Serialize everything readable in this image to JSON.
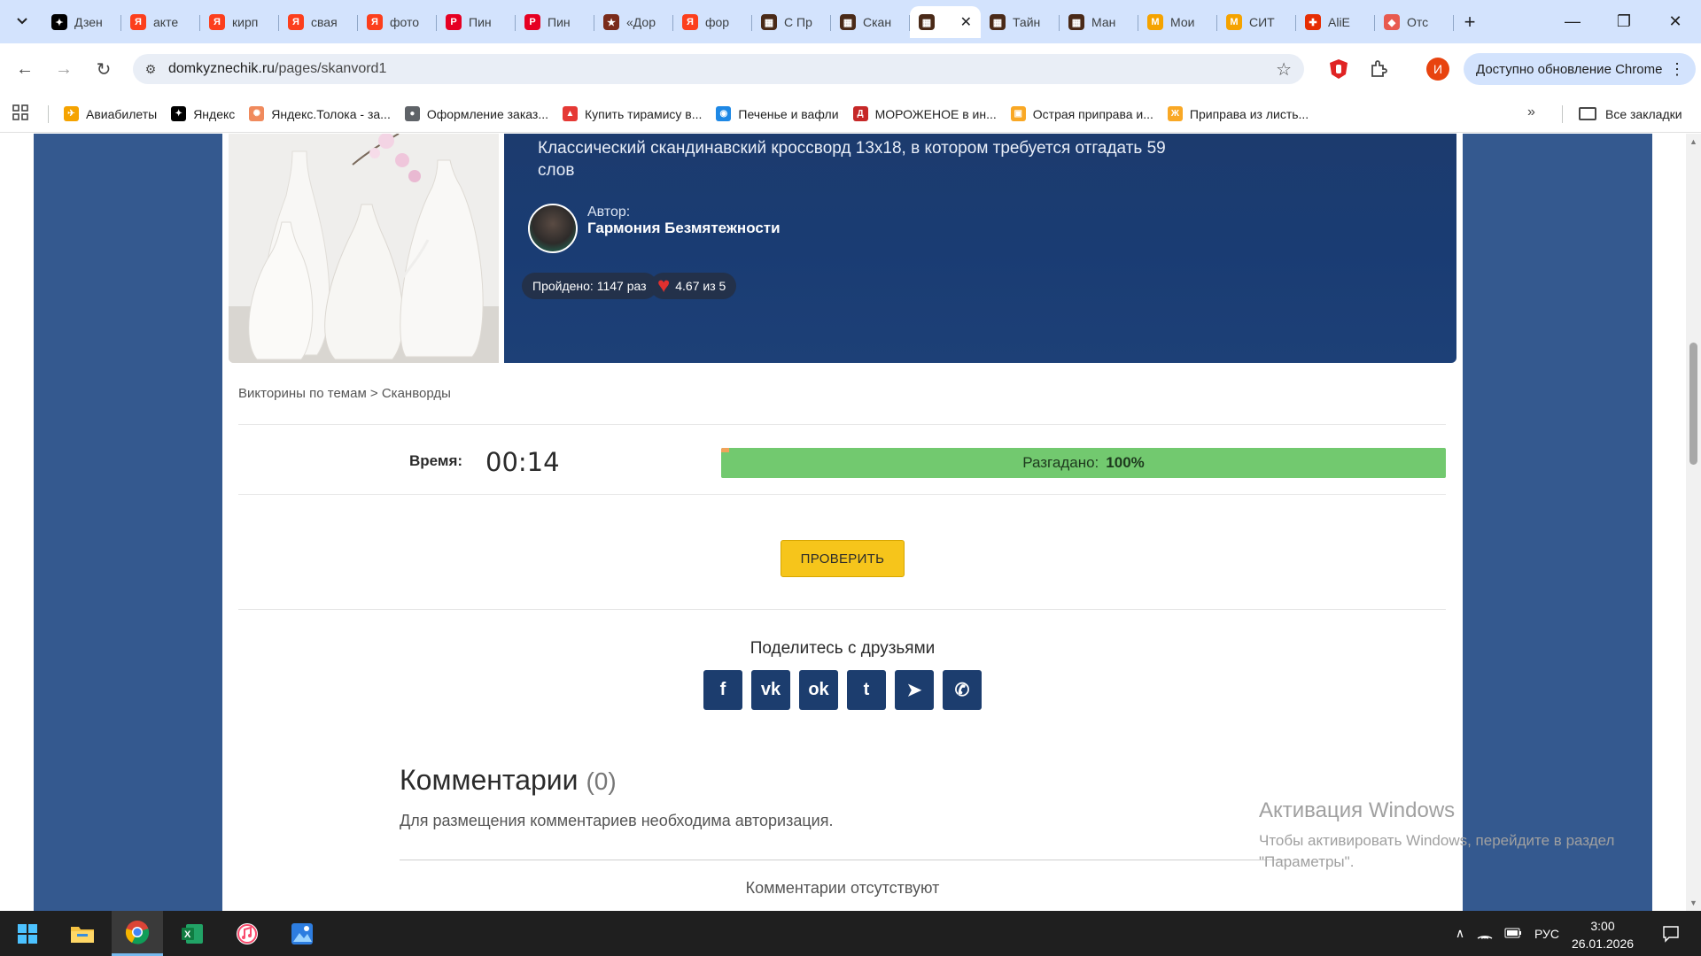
{
  "browser": {
    "tabs": [
      {
        "title": "Дзен",
        "fav_color": "#000000",
        "fav_glyph": "✦"
      },
      {
        "title": "акте",
        "fav_color": "#fc3f1d",
        "fav_glyph": "Я"
      },
      {
        "title": "кирп",
        "fav_color": "#fc3f1d",
        "fav_glyph": "Я"
      },
      {
        "title": "свая",
        "fav_color": "#fc3f1d",
        "fav_glyph": "Я"
      },
      {
        "title": "фото",
        "fav_color": "#fc3f1d",
        "fav_glyph": "Я"
      },
      {
        "title": "Пин",
        "fav_color": "#e60023",
        "fav_glyph": "P"
      },
      {
        "title": "Пин",
        "fav_color": "#e60023",
        "fav_glyph": "P"
      },
      {
        "title": "«Дор",
        "fav_color": "#7a2b1a",
        "fav_glyph": "★"
      },
      {
        "title": "фор",
        "fav_color": "#fc3f1d",
        "fav_glyph": "Я"
      },
      {
        "title": "С Пр",
        "fav_color": "#4a2a18",
        "fav_glyph": "▦"
      },
      {
        "title": "Скан",
        "fav_color": "#4a2a18",
        "fav_glyph": "▦"
      },
      {
        "title": "",
        "fav_color": "#4a2a18",
        "fav_glyph": "▦",
        "active": true
      },
      {
        "title": "Тайн",
        "fav_color": "#4a2a18",
        "fav_glyph": "▦"
      },
      {
        "title": "Ман",
        "fav_color": "#4a2a18",
        "fav_glyph": "▦"
      },
      {
        "title": "Мои",
        "fav_color": "#f5a300",
        "fav_glyph": "М"
      },
      {
        "title": "СИТ",
        "fav_color": "#f5a300",
        "fav_glyph": "М"
      },
      {
        "title": "AliE",
        "fav_color": "#e62e04",
        "fav_glyph": "✚"
      },
      {
        "title": "Отс",
        "fav_color": "#e85a4f",
        "fav_glyph": "◆"
      }
    ],
    "url_host": "domkyznechik.ru",
    "url_path": "/pages/skanvord1",
    "update_label": "Доступно обновление Chrome",
    "profile_initial": "И",
    "bookmarks": [
      {
        "label": "Авиабилеты",
        "color": "#f5a300",
        "glyph": "✈"
      },
      {
        "label": "Яндекс",
        "color": "#000000",
        "glyph": "✦"
      },
      {
        "label": "Яндекс.Толока - за...",
        "color": "#f08a5d",
        "glyph": "✺"
      },
      {
        "label": "Оформление заказ...",
        "color": "#5f6368",
        "glyph": "●"
      },
      {
        "label": "Купить тирамису в...",
        "color": "#e53935",
        "glyph": "▲"
      },
      {
        "label": "Печенье и вафли",
        "color": "#1e88e5",
        "glyph": "◉"
      },
      {
        "label": "МОРОЖЕНОЕ в ин...",
        "color": "#c62828",
        "glyph": "Д"
      },
      {
        "label": "Острая приправа и...",
        "color": "#f9a825",
        "glyph": "▣"
      },
      {
        "label": "Приправа из листь...",
        "color": "#f9a825",
        "glyph": "Ж"
      }
    ],
    "all_bookmarks": "Все закладки"
  },
  "page": {
    "description": "Классический скандинавский кроссворд 13x18, в котором требуется отгадать 59 слов",
    "author_label": "Автор:",
    "author_name": "Гармония Безмятежности",
    "passed": "Пройдено: 1147 раз",
    "rating": "4.67 из 5",
    "breadcrumb": "Викторины по темам > Сканворды",
    "time_label": "Время:",
    "time_value": "00:14",
    "solved_label": "Разгадано:",
    "solved_value": "100%",
    "solved_fraction": 1.0,
    "check_button": "ПРОВЕРИТЬ",
    "share_title": "Поделитесь с друзьями",
    "share_buttons": [
      {
        "name": "facebook",
        "glyph": "f"
      },
      {
        "name": "vk",
        "glyph": "vk"
      },
      {
        "name": "odnoklassniki",
        "glyph": "ok"
      },
      {
        "name": "twitter",
        "glyph": "t"
      },
      {
        "name": "telegram",
        "glyph": "➤"
      },
      {
        "name": "whatsapp",
        "glyph": "✆"
      }
    ],
    "comments_title": "Комментарии",
    "comments_count": "(0)",
    "comments_note": "Для размещения комментариев необходима авторизация.",
    "comments_empty": "Комментарии отсутствуют"
  },
  "watermark": {
    "title": "Активация Windows",
    "text": "Чтобы активировать Windows, перейдите в раздел \"Параметры\"."
  },
  "taskbar": {
    "lang": "РУС",
    "time": "3:00",
    "date": "26.01.2026"
  }
}
